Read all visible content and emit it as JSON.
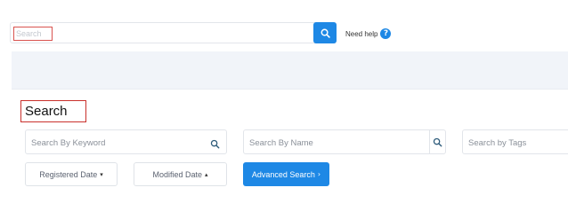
{
  "header": {
    "search_placeholder": "Search",
    "help_label": "Need help",
    "help_icon_glyph": "?"
  },
  "section": {
    "title": "Search"
  },
  "filters": {
    "keyword_placeholder": "Search By Keyword",
    "name_placeholder": "Search By Name",
    "tags_placeholder": "Search by Tags"
  },
  "buttons": {
    "registered_label": "Registered Date",
    "registered_caret": "▾",
    "modified_label": "Modified Date",
    "modified_caret": "▴",
    "advanced_label": "Advanced Search",
    "advanced_caret": "›"
  },
  "colors": {
    "accent": "#1e88e5",
    "highlight_border": "#d9534f",
    "banner": "#f1f4f9"
  }
}
